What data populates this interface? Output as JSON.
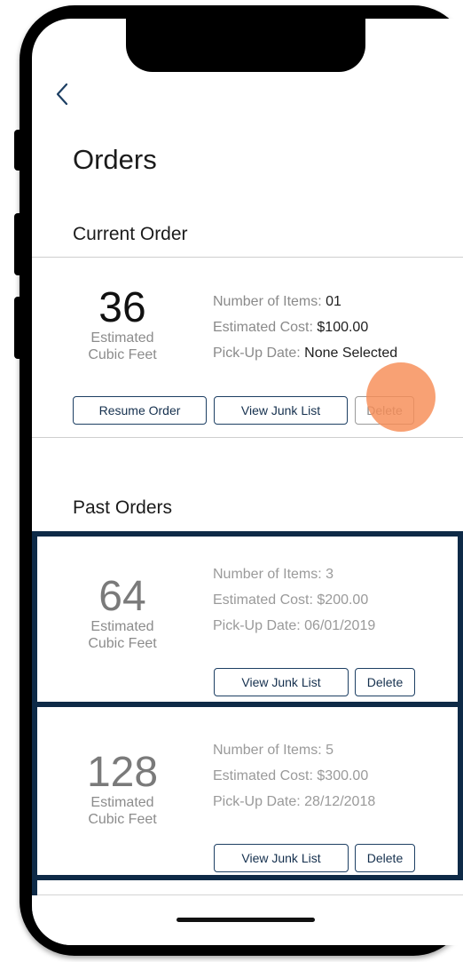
{
  "nav": {
    "back_icon": "chevron-left-icon"
  },
  "page": {
    "title": "Orders"
  },
  "current": {
    "section_title": "Current Order",
    "order": {
      "cubic_feet": "36",
      "cubic_label_line1": "Estimated",
      "cubic_label_line2": "Cubic Feet",
      "items_label": "Number of Items:",
      "items_value": "01",
      "cost_label": "Estimated Cost:",
      "cost_value": "$100.00",
      "pickup_label": "Pick-Up Date:",
      "pickup_value": "None Selected",
      "resume_label": "Resume Order",
      "view_label": "View Junk List",
      "delete_label": "Delete"
    }
  },
  "past": {
    "section_title": "Past Orders",
    "orders": [
      {
        "cubic_feet": "64",
        "cubic_label_line1": "Estimated",
        "cubic_label_line2": "Cubic Feet",
        "items_label": "Number of Items:",
        "items_value": "3",
        "cost_label": "Estimated Cost:",
        "cost_value": "$200.00",
        "pickup_label": "Pick-Up Date:",
        "pickup_value": "06/01/2019",
        "view_label": "View Junk List",
        "delete_label": "Delete"
      },
      {
        "cubic_feet": "128",
        "cubic_label_line1": "Estimated",
        "cubic_label_line2": "Cubic Feet",
        "items_label": "Number of Items:",
        "items_value": "5",
        "cost_label": "Estimated Cost:",
        "cost_value": "$300.00",
        "pickup_label": "Pick-Up Date:",
        "pickup_value": "28/12/2018",
        "view_label": "View Junk List",
        "delete_label": "Delete"
      }
    ]
  },
  "colors": {
    "navy": "#0e2a47",
    "button_border": "#1d3f63",
    "touch_indicator": "#f68c56"
  }
}
